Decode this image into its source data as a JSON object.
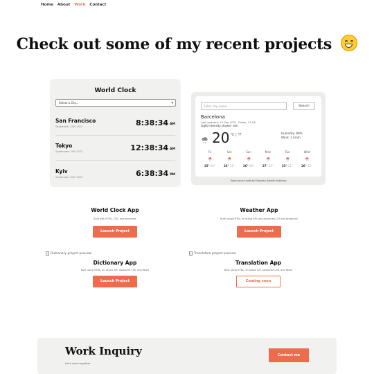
{
  "nav": {
    "items": [
      "Home",
      "About",
      "Work",
      "Contact"
    ],
    "active": "Work"
  },
  "hero": {
    "title": "Check out some of my recent projects"
  },
  "clock": {
    "title": "World Clock",
    "select_value": "Select a City...",
    "cities": [
      {
        "name": "San Francisco",
        "date": "September 15th 2022",
        "time": "8:38:34",
        "ampm": "AM"
      },
      {
        "name": "Tokyo",
        "date": "September 15th 2022",
        "time": "12:38:34",
        "ampm": "AM"
      },
      {
        "name": "Kyiv",
        "date": "September 15th 2022",
        "time": "6:38:34",
        "ampm": "PM"
      }
    ]
  },
  "weather": {
    "placeholder": "Enter city name...",
    "search_label": "Search",
    "city": "Barcelona",
    "updated": "Last updated: 15 Sep 2022, Friday, 17:56",
    "description": "Light intensity shower rain",
    "temp": "20",
    "unit": "°C | °F",
    "humidity": "Humidity: 88%",
    "wind": "Wind: 1 km/h",
    "forecast": [
      {
        "day": "Fri",
        "hi": "25°",
        "lo": "20°"
      },
      {
        "day": "Sat",
        "hi": "26°",
        "lo": "21°"
      },
      {
        "day": "Sun",
        "hi": "26°",
        "lo": "24°"
      },
      {
        "day": "Mon",
        "hi": "27°",
        "lo": "22°"
      },
      {
        "day": "Tue",
        "hi": "25°",
        "lo": "21°"
      },
      {
        "day": "Wed",
        "hi": "26°",
        "lo": "23°"
      }
    ],
    "credit": "Open-source code by Elizaveta Dzhokh Kudinova"
  },
  "projects": [
    {
      "title": "World Clock App",
      "desc": "Built with HTML, CSS, and Javascript",
      "button": "Launch Project"
    },
    {
      "title": "Weather App",
      "desc": "Built using HTML, an active API, and advanced CSS and Javascript",
      "button": "Launch Project"
    },
    {
      "title": "Dictionary App",
      "desc": "Built using HTML, an active API, advanced CSS, and React",
      "button": "Launch Project",
      "image_alt": "Dictionary project preview"
    },
    {
      "title": "Translation App",
      "desc": "Built using HTML, an active API, advanced CSS, and React",
      "button": "Coming soon",
      "image_alt": "Translation project preview"
    }
  ],
  "inquiry": {
    "title": "Work Inquiry",
    "subtitle": "Let's work together",
    "button": "Contact me"
  },
  "colors": {
    "accent": "#ee6c4d",
    "card_bg": "#f1f1ef"
  }
}
